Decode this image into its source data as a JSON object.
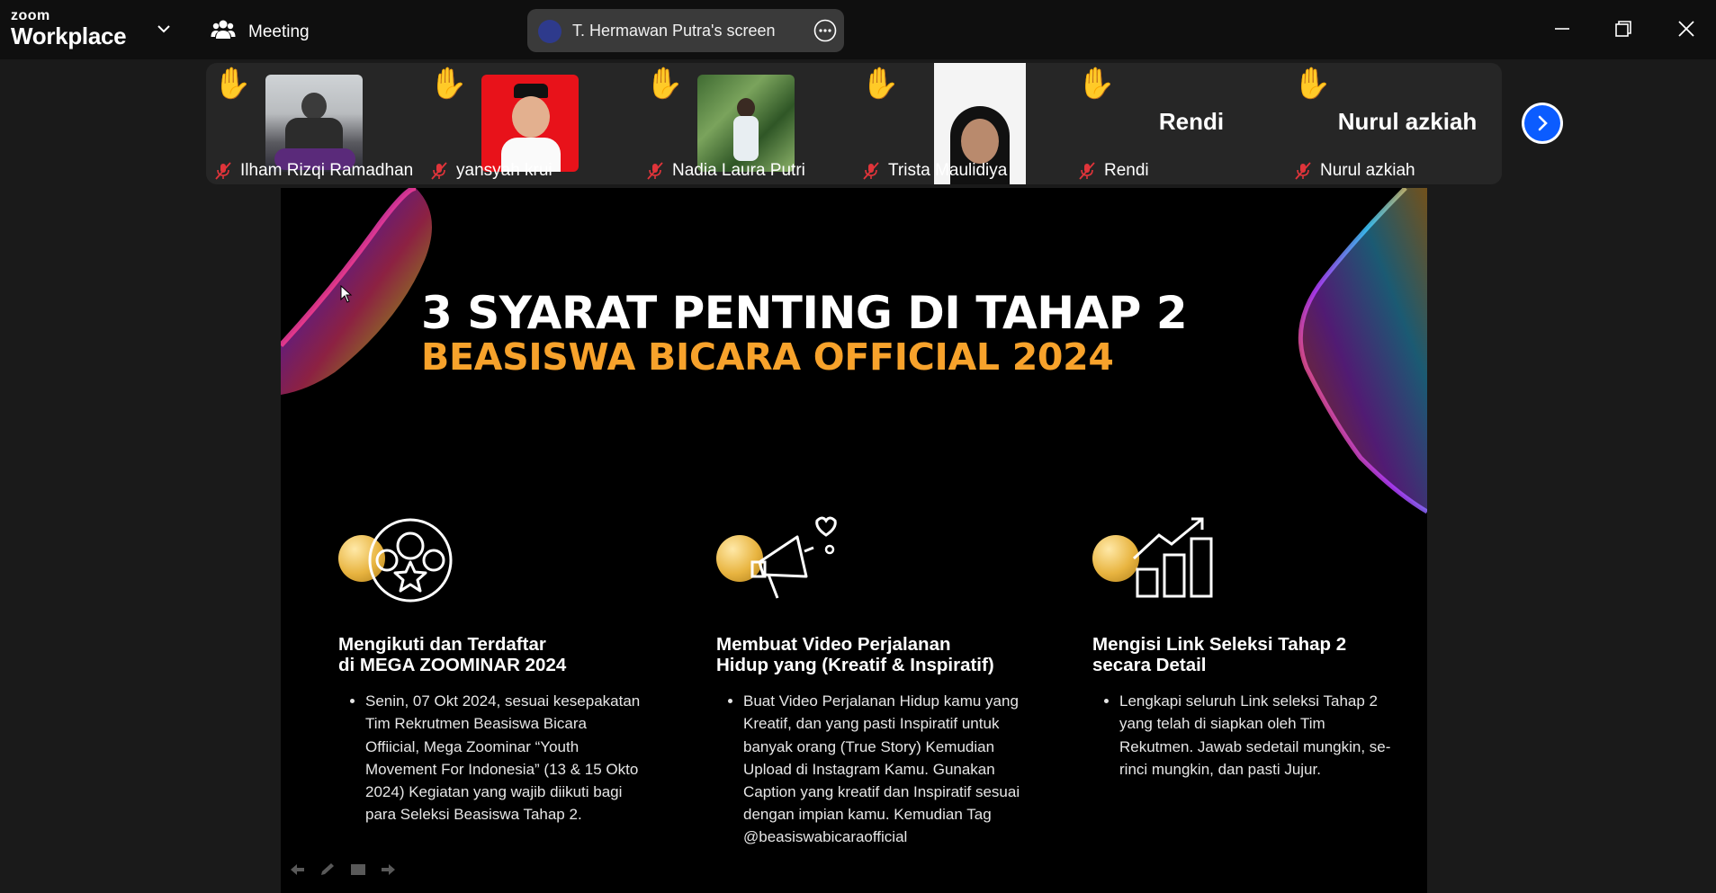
{
  "app": {
    "logo_top": "zoom",
    "logo_bottom": "Workplace",
    "menu_label": "Meeting",
    "share_label": "T. Hermawan Putra's screen"
  },
  "participants": [
    {
      "name": "Ilham Rizqi Ramadhan",
      "has_video": true,
      "hand_raised": true,
      "muted": true
    },
    {
      "name": "yansyah krui",
      "has_video": true,
      "hand_raised": true,
      "muted": true
    },
    {
      "name": "Nadia Laura Putri",
      "has_video": true,
      "hand_raised": true,
      "muted": true
    },
    {
      "name": "Trista Maulidiya",
      "has_video": true,
      "hand_raised": true,
      "muted": true
    },
    {
      "name": "Rendi",
      "display_text": "Rendi",
      "has_video": false,
      "hand_raised": true,
      "muted": true
    },
    {
      "name": "Nurul azkiah",
      "display_text": "Nurul azkiah",
      "has_video": false,
      "hand_raised": true,
      "muted": true
    }
  ],
  "slide": {
    "title": "3 SYARAT PENTING DI TAHAP 2",
    "subtitle": "BEASISWA BICARA OFFICIAL 2024",
    "accent_color": "#f7a22b",
    "columns": [
      {
        "icon": "coins-star-icon",
        "heading_line1": "Mengikuti dan Terdaftar",
        "heading_line2": "di MEGA ZOOMINAR 2024",
        "bullet": "Senin, 07 Okt 2024, sesuai kesepakatan Tim Rekrutmen Beasiswa Bicara Offiicial, Mega Zoominar “Youth Movement For Indonesia” (13 & 15 Okto 2024) Kegiatan yang wajib diikuti bagi para Seleksi Beasiswa Tahap 2."
      },
      {
        "icon": "megaphone-icon",
        "heading_line1": "Membuat Video Perjalanan",
        "heading_line2": "Hidup yang (Kreatif & Inspiratif)",
        "bullet": "Buat Video Perjalanan Hidup kamu yang Kreatif, dan yang pasti Inspiratif untuk banyak orang (True Story) Kemudian Upload di Instagram Kamu. Gunakan Caption yang kreatif dan Inspiratif sesuai dengan impian kamu. Kemudian Tag @beasiswabicaraofficial"
      },
      {
        "icon": "growth-chart-icon",
        "heading_line1": "Mengisi Link Seleksi Tahap 2",
        "heading_line2": "secara Detail",
        "bullet": "Lengkapi seluruh Link seleksi Tahap 2 yang telah di siapkan oleh Tim Rekutmen. Jawab sedetail mungkin, se-rinci mungkin, dan pasti Jujur."
      }
    ]
  }
}
